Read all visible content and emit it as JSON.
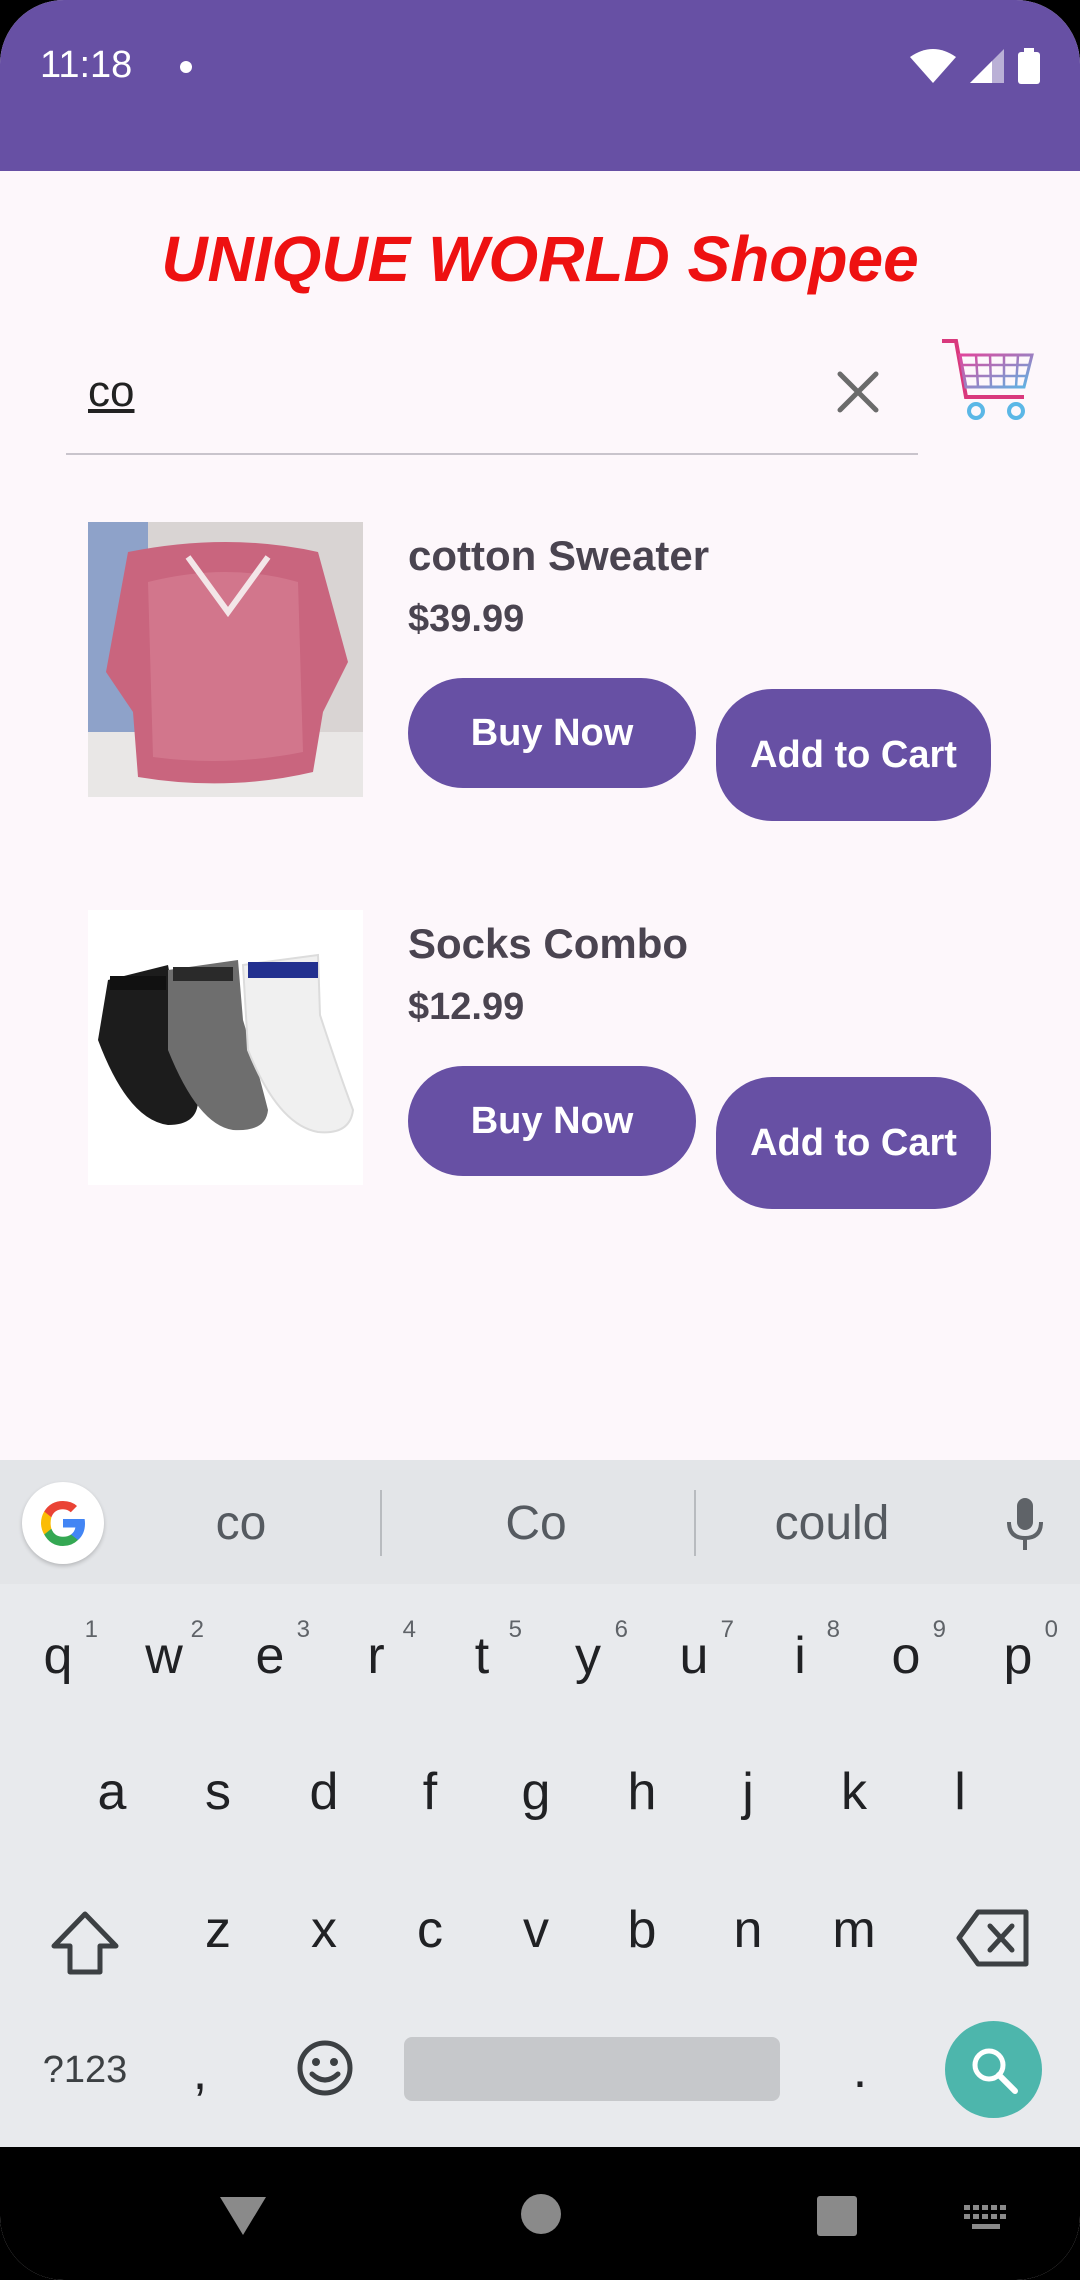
{
  "status_bar": {
    "time": "11:18"
  },
  "header": {
    "title": "UNIQUE WORLD Shopee"
  },
  "search": {
    "value": "co",
    "clear_icon": "close-icon",
    "cart_icon": "shopping-cart-icon"
  },
  "products": [
    {
      "name": "cotton Sweater",
      "price": "$39.99",
      "buy_label": "Buy Now",
      "cart_label": "Add to Cart",
      "image": "pink-sweater"
    },
    {
      "name": "Socks Combo",
      "price": "$12.99",
      "buy_label": "Buy Now",
      "cart_label": "Add to Cart",
      "image": "socks"
    }
  ],
  "keyboard": {
    "suggestions": [
      "co",
      "Co",
      "could"
    ],
    "row1": [
      "q",
      "w",
      "e",
      "r",
      "t",
      "y",
      "u",
      "i",
      "o",
      "p"
    ],
    "row1_hints": [
      "1",
      "2",
      "3",
      "4",
      "5",
      "6",
      "7",
      "8",
      "9",
      "0"
    ],
    "row2": [
      "a",
      "s",
      "d",
      "f",
      "g",
      "h",
      "j",
      "k",
      "l"
    ],
    "row3": [
      "z",
      "x",
      "c",
      "v",
      "b",
      "n",
      "m"
    ],
    "symbols_label": "?123",
    "comma": ",",
    "period": "."
  },
  "colors": {
    "primary": "#6750a4",
    "title": "#ee1111",
    "search_key": "#4db6ac"
  }
}
